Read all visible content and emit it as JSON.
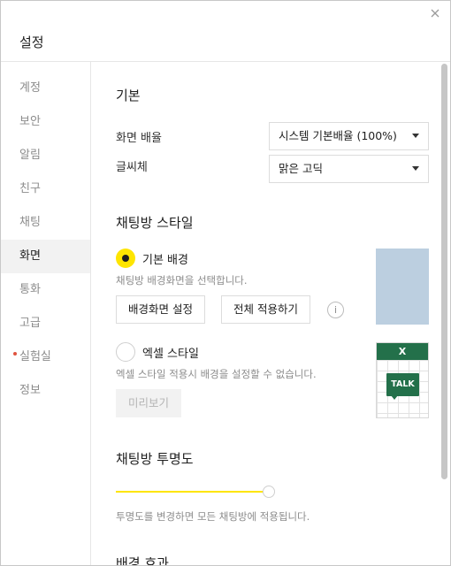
{
  "window": {
    "title": "설정"
  },
  "sidebar": {
    "items": [
      {
        "label": "계정"
      },
      {
        "label": "보안"
      },
      {
        "label": "알림"
      },
      {
        "label": "친구"
      },
      {
        "label": "채팅"
      },
      {
        "label": "화면",
        "active": true
      },
      {
        "label": "통화"
      },
      {
        "label": "고급"
      },
      {
        "label": "실험실",
        "new_dot": true
      },
      {
        "label": "정보"
      }
    ]
  },
  "basic": {
    "title": "기본",
    "zoom_label": "화면 배율",
    "zoom_value": "시스템 기본배율 (100%)",
    "font_label": "글씨체",
    "font_value": "맑은 고딕"
  },
  "chatroom_style": {
    "title": "채팅방 스타일",
    "default_bg": {
      "label": "기본 배경",
      "selected": true,
      "desc": "채팅방 배경화면을 선택합니다.",
      "set_button": "배경화면 설정",
      "apply_all_button": "전체 적용하기",
      "info_icon": "i",
      "swatch_color": "#bccfe0"
    },
    "excel": {
      "label": "엑셀 스타일",
      "selected": false,
      "desc": "엑셀 스타일 적용시 배경을 설정할 수 없습니다.",
      "preview_button": "미리보기",
      "thumb_header": "X",
      "thumb_badge": "TALK",
      "thumb_color": "#23704a"
    }
  },
  "transparency": {
    "title": "채팅방 투명도",
    "level_percent": 100,
    "desc": "투명도를 변경하면 모든 채팅방에 적용됩니다."
  },
  "effects": {
    "title": "배경 효과"
  },
  "colors": {
    "accent": "#fee500",
    "excel_green": "#23704a"
  }
}
